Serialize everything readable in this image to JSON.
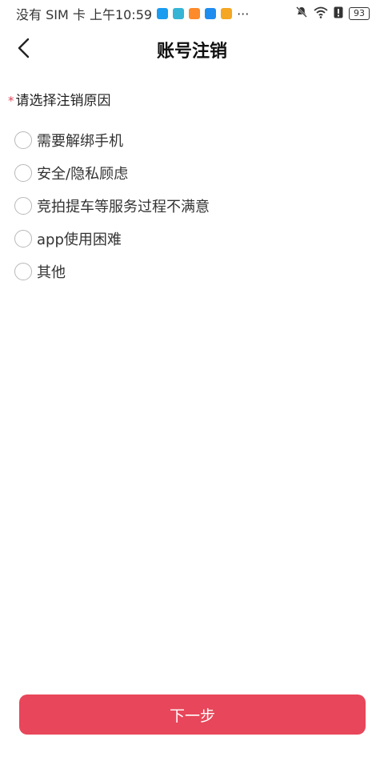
{
  "status_bar": {
    "carrier_time": "没有 SIM 卡 上午10:59",
    "more": "···",
    "battery": "93",
    "icons": [
      "bell-off-icon",
      "wifi-icon",
      "alert-icon",
      "battery-icon"
    ],
    "app_badges": [
      "#1a9cf0",
      "#35b4d6",
      "#ff8a2a",
      "#1f8cf0",
      "#f5a623"
    ]
  },
  "header": {
    "title": "账号注销",
    "back_icon": "chevron-left-icon"
  },
  "form": {
    "required_mark": "*",
    "label": "请选择注销原因",
    "options": [
      {
        "label": "需要解绑手机"
      },
      {
        "label": "安全/隐私顾虑"
      },
      {
        "label": "竞拍提车等服务过程不满意"
      },
      {
        "label": "app使用困难"
      },
      {
        "label": "其他"
      }
    ]
  },
  "footer": {
    "next_label": "下一步",
    "accent_color": "#e8465a"
  }
}
